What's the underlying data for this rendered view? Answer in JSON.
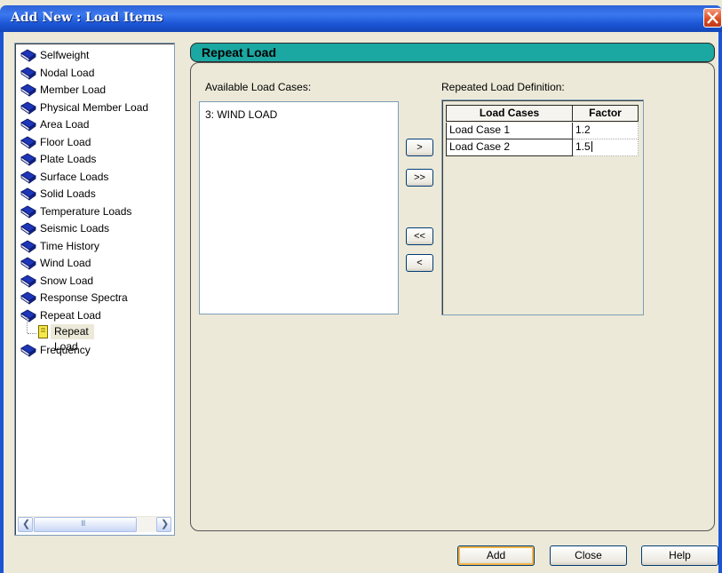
{
  "window": {
    "title": "Add New : Load Items"
  },
  "tree": {
    "items": [
      {
        "label": "Selfweight"
      },
      {
        "label": "Nodal Load"
      },
      {
        "label": "Member Load"
      },
      {
        "label": "Physical Member Load"
      },
      {
        "label": "Area Load"
      },
      {
        "label": "Floor Load"
      },
      {
        "label": "Plate Loads"
      },
      {
        "label": "Surface Loads"
      },
      {
        "label": "Solid Loads"
      },
      {
        "label": "Temperature Loads"
      },
      {
        "label": "Seismic Loads"
      },
      {
        "label": "Time History"
      },
      {
        "label": "Wind Load"
      },
      {
        "label": "Snow Load"
      },
      {
        "label": "Response Spectra"
      },
      {
        "label": "Repeat Load"
      }
    ],
    "child": {
      "label": "Repeat Load",
      "selected": true
    },
    "last": {
      "label": "Frequency"
    },
    "scrollbar_thumb_glyph": "III"
  },
  "section": {
    "title": "Repeat Load"
  },
  "available": {
    "label": "Available Load Cases:",
    "items": [
      "3: WIND LOAD"
    ]
  },
  "transfer_buttons": {
    "add_one": ">",
    "add_all": ">>",
    "remove_all": "<<",
    "remove_one": "<"
  },
  "definition": {
    "label": "Repeated Load Definition:",
    "columns": [
      "Load Cases",
      "Factor"
    ],
    "rows": [
      {
        "load_case": "Load Case 1",
        "factor": "1.2"
      },
      {
        "load_case": "Load Case 2",
        "factor": "1.5"
      }
    ]
  },
  "buttons": {
    "add": "Add",
    "close": "Close",
    "help": "Help"
  },
  "colors": {
    "titlebar": "#1b55d4",
    "section_header": "#1ba7a2",
    "close_button": "#d84a21"
  }
}
